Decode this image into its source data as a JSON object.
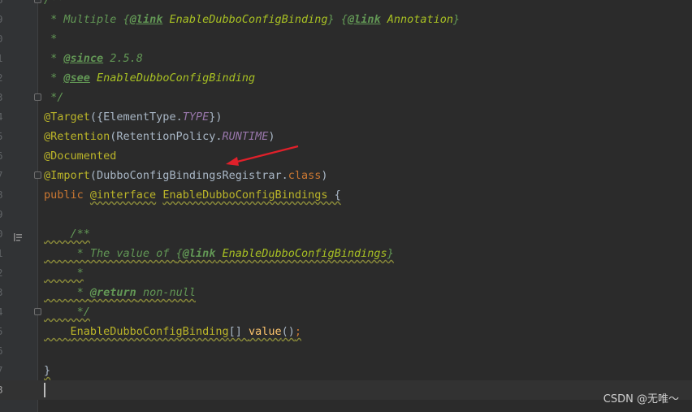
{
  "editor": {
    "lines": [
      {
        "num": "8",
        "segments": [
          {
            "t": "/**",
            "c": "doc"
          }
        ]
      },
      {
        "num": "9",
        "segments": [
          {
            "t": " * Multiple ",
            "c": "doc"
          },
          {
            "t": "{",
            "c": "doc"
          },
          {
            "t": "@link",
            "c": "doctag"
          },
          {
            "t": " ",
            "c": "doc"
          },
          {
            "t": "EnableDubboConfigBinding",
            "c": "docname"
          },
          {
            "t": "} {",
            "c": "doc"
          },
          {
            "t": "@link",
            "c": "doctag"
          },
          {
            "t": " ",
            "c": "doc"
          },
          {
            "t": "Annotation",
            "c": "docname"
          },
          {
            "t": "}",
            "c": "doc"
          }
        ]
      },
      {
        "num": "0",
        "segments": [
          {
            "t": " *",
            "c": "doc"
          }
        ]
      },
      {
        "num": "1",
        "segments": [
          {
            "t": " * ",
            "c": "doc"
          },
          {
            "t": "@since",
            "c": "doctag"
          },
          {
            "t": " 2.5.8",
            "c": "doc"
          }
        ]
      },
      {
        "num": "2",
        "segments": [
          {
            "t": " * ",
            "c": "doc"
          },
          {
            "t": "@see",
            "c": "doctag"
          },
          {
            "t": " ",
            "c": "doc"
          },
          {
            "t": "EnableDubboConfigBinding",
            "c": "docname"
          }
        ]
      },
      {
        "num": "3",
        "segments": [
          {
            "t": " */",
            "c": "doc"
          }
        ]
      },
      {
        "num": "4",
        "segments": [
          {
            "t": "@Target",
            "c": "ann"
          },
          {
            "t": "({ElementType.",
            "c": "plain"
          },
          {
            "t": "TYPE",
            "c": "const"
          },
          {
            "t": "})",
            "c": "plain"
          }
        ]
      },
      {
        "num": "5",
        "segments": [
          {
            "t": "@Retention",
            "c": "ann"
          },
          {
            "t": "(RetentionPolicy.",
            "c": "plain"
          },
          {
            "t": "RUNTIME",
            "c": "const"
          },
          {
            "t": ")",
            "c": "plain"
          }
        ]
      },
      {
        "num": "6",
        "segments": [
          {
            "t": "@Documented",
            "c": "ann"
          }
        ]
      },
      {
        "num": "7",
        "segments": [
          {
            "t": "@Import",
            "c": "ann"
          },
          {
            "t": "(DubboConfigBindingsRegistrar.",
            "c": "plain"
          },
          {
            "t": "class",
            "c": "kw"
          },
          {
            "t": ")",
            "c": "plain"
          }
        ]
      },
      {
        "num": "8",
        "segments": [
          {
            "t": "public ",
            "c": "kw"
          },
          {
            "t": "@interface",
            "c": "ann wavy"
          },
          {
            "t": " ",
            "c": "plain"
          },
          {
            "t": "EnableDubboConfigBindings",
            "c": "ann wavy"
          },
          {
            "t": " {",
            "c": "plain wavy"
          }
        ]
      },
      {
        "num": "9",
        "segments": []
      },
      {
        "num": "0",
        "segments": [
          {
            "t": "    /**",
            "c": "doc wavy"
          }
        ]
      },
      {
        "num": "1",
        "segments": [
          {
            "t": "     * The value of ",
            "c": "doc wavy"
          },
          {
            "t": "{",
            "c": "doc wavy"
          },
          {
            "t": "@link",
            "c": "doctag wavy"
          },
          {
            "t": " ",
            "c": "doc wavy"
          },
          {
            "t": "EnableDubboConfigBindings",
            "c": "docname wavy"
          },
          {
            "t": "}",
            "c": "doc wavy"
          }
        ]
      },
      {
        "num": "2",
        "segments": [
          {
            "t": "     *",
            "c": "doc wavy"
          }
        ]
      },
      {
        "num": "3",
        "segments": [
          {
            "t": "     * ",
            "c": "doc wavy"
          },
          {
            "t": "@return",
            "c": "doctag wavy"
          },
          {
            "t": " non-null",
            "c": "doc wavy"
          }
        ]
      },
      {
        "num": "4",
        "segments": [
          {
            "t": "     */",
            "c": "doc wavy"
          }
        ]
      },
      {
        "num": "5",
        "segments": [
          {
            "t": "    ",
            "c": "plain wavy"
          },
          {
            "t": "EnableDubboConfigBinding",
            "c": "ann wavy"
          },
          {
            "t": "[] ",
            "c": "plain wavy"
          },
          {
            "t": "value",
            "c": "method wavy"
          },
          {
            "t": "()",
            "c": "plain wavy"
          },
          {
            "t": ";",
            "c": "kw wavy"
          }
        ]
      },
      {
        "num": "6",
        "segments": []
      },
      {
        "num": "7",
        "segments": [
          {
            "t": "}",
            "c": "plain wavy"
          }
        ]
      },
      {
        "num": "8",
        "segments": [],
        "current": true
      }
    ]
  },
  "watermark": "CSDN @无唯～",
  "colors": {
    "background": "#2b2b2b",
    "gutter": "#313335",
    "javadoc": "#629755",
    "annotation": "#bbb529",
    "keyword": "#cc7832",
    "text": "#a9b7c6",
    "constant": "#9876aa",
    "arrow": "#e0202a"
  },
  "icons": {
    "fold_markers": "fold-marker-icon",
    "implementation_marker": "implementation-gutter-icon",
    "annotation_arrow": "red-arrow-icon"
  }
}
